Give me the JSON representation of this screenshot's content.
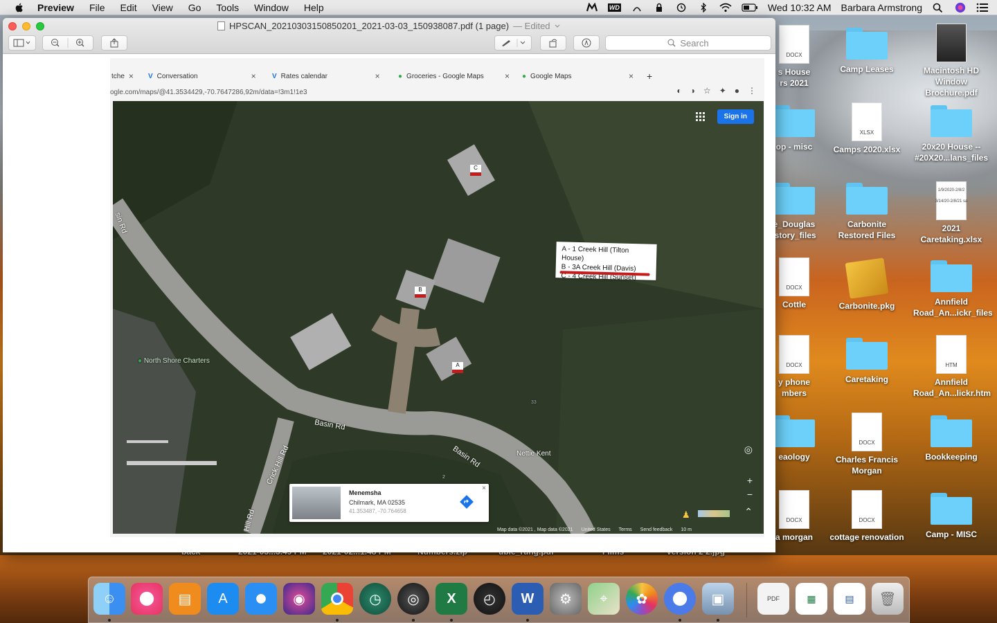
{
  "menubar": {
    "app_name": "Preview",
    "menus": [
      "File",
      "Edit",
      "View",
      "Go",
      "Tools",
      "Window",
      "Help"
    ],
    "clock": "Wed 10:32 AM",
    "user": "Barbara Armstrong",
    "status_icons": [
      "malwarebytes-icon",
      "wd-icon",
      "wifi-scan-icon",
      "lock-icon",
      "time-machine-icon",
      "bluetooth-icon",
      "wifi-icon",
      "battery-icon",
      "search-icon",
      "siri-icon",
      "menu-list-icon"
    ],
    "wd_label": "WD"
  },
  "window": {
    "title": "HPSCAN_20210303150850201_2021-03-03_150938087.pdf (1 page)",
    "edited": "— Edited",
    "search_placeholder": "Search"
  },
  "scan": {
    "tabs": [
      {
        "label": "tche"
      },
      {
        "label": "Conversation"
      },
      {
        "label": "Rates calendar"
      },
      {
        "label": "Groceries - Google Maps"
      },
      {
        "label": "Google Maps"
      }
    ],
    "address": "ogle.com/maps/@41.3534429,-70.7647286,92m/data=!3m1!1e3",
    "sign_in": "Sign in",
    "legend": [
      "A - 1 Creek Hill (Tilton House)",
      "B - 3A Creek Hill (Davis)",
      "C - 4 Creek Hill (Sunset)"
    ],
    "markers": [
      "A",
      "B",
      "C"
    ],
    "roads": [
      "Basin Rd",
      "Basin Rd",
      "Crick Hill Rd",
      "Hill Rd",
      "sin Rd"
    ],
    "places": [
      "North Shore Charters",
      "Nettie Kent"
    ],
    "number_labels": [
      "33",
      "2"
    ],
    "info_card": {
      "name": "Menemsha",
      "address": "Chilmark, MA 02535",
      "coords": "41.353487, -70.764658"
    },
    "footer": [
      "Map data ©2021 , Map data ©2021",
      "United States",
      "Terms",
      "Send feedback",
      "10 m"
    ]
  },
  "desktop": {
    "icons": [
      {
        "label": "s House\nrs 2021",
        "type": "docx"
      },
      {
        "label": "Camp Leases",
        "type": "folder"
      },
      {
        "label": "Macintosh HD\nWindow\nBrochure.pdf",
        "type": "pdf"
      },
      {
        "label": "op - misc",
        "type": "folder"
      },
      {
        "label": "Camps 2020.xlsx",
        "type": "xlsx"
      },
      {
        "label": "20x20 House --\n#20X20...lans_files",
        "type": "folder"
      },
      {
        "label": "e_Douglas\nistory_files",
        "type": "folder"
      },
      {
        "label": "Carbonite\nRestored Files",
        "type": "folder"
      },
      {
        "label": "2021\nCaretaking.xlsx",
        "type": "xlsx"
      },
      {
        "label": "Cottle",
        "type": "docx"
      },
      {
        "label": "Carbonite.pkg",
        "type": "pkg"
      },
      {
        "label": "Annfield\nRoad_An...ickr_files",
        "type": "folder"
      },
      {
        "label": "y phone\nmbers",
        "type": "docx"
      },
      {
        "label": "Caretaking",
        "type": "folder"
      },
      {
        "label": "Annfield\nRoad_An...lickr.htm",
        "type": "htm"
      },
      {
        "label": "eaology",
        "type": "folder"
      },
      {
        "label": "Charles Francis\nMorgan",
        "type": "docx"
      },
      {
        "label": "Bookkeeping",
        "type": "folder"
      },
      {
        "label": "a morgan",
        "type": "docx"
      },
      {
        "label": "cottage renovation",
        "type": "docx"
      },
      {
        "label": "Camp - MISC",
        "type": "folder"
      }
    ],
    "file_type_labels": {
      "docx": "DOCX",
      "xlsx": "XLSX",
      "htm": "HTM"
    },
    "xlsx_thumb_text": "1/9/2020-2/8/2\n3/14/20-2/8/21 sa",
    "peeking_labels": [
      "back",
      "2021-03...3.49 PM",
      "2021-02...1.48 PM",
      "Numbers.zip",
      "uble_rung.pdf",
      "Films",
      "version 2 2.jpg"
    ]
  },
  "dock": {
    "items": [
      "finder-icon",
      "itunes-icon",
      "books-icon",
      "app-store-icon",
      "safari-icon",
      "siri-icon",
      "chrome-icon",
      "time-machine-icon",
      "photo-booth-icon",
      "excel-icon",
      "dashboard-icon",
      "word-icon",
      "system-preferences-icon",
      "maps-icon",
      "photos-icon",
      "chrome-alt-icon",
      "preview-icon",
      "pdf-doc-icon",
      "excel-doc-icon",
      "word-doc-icon",
      "trash-icon"
    ],
    "pdf_label": "PDF"
  },
  "colors": {
    "accent_blue": "#1a73e8",
    "folder_blue": "#6dd0fa",
    "marker_red": "#c21c1c"
  }
}
